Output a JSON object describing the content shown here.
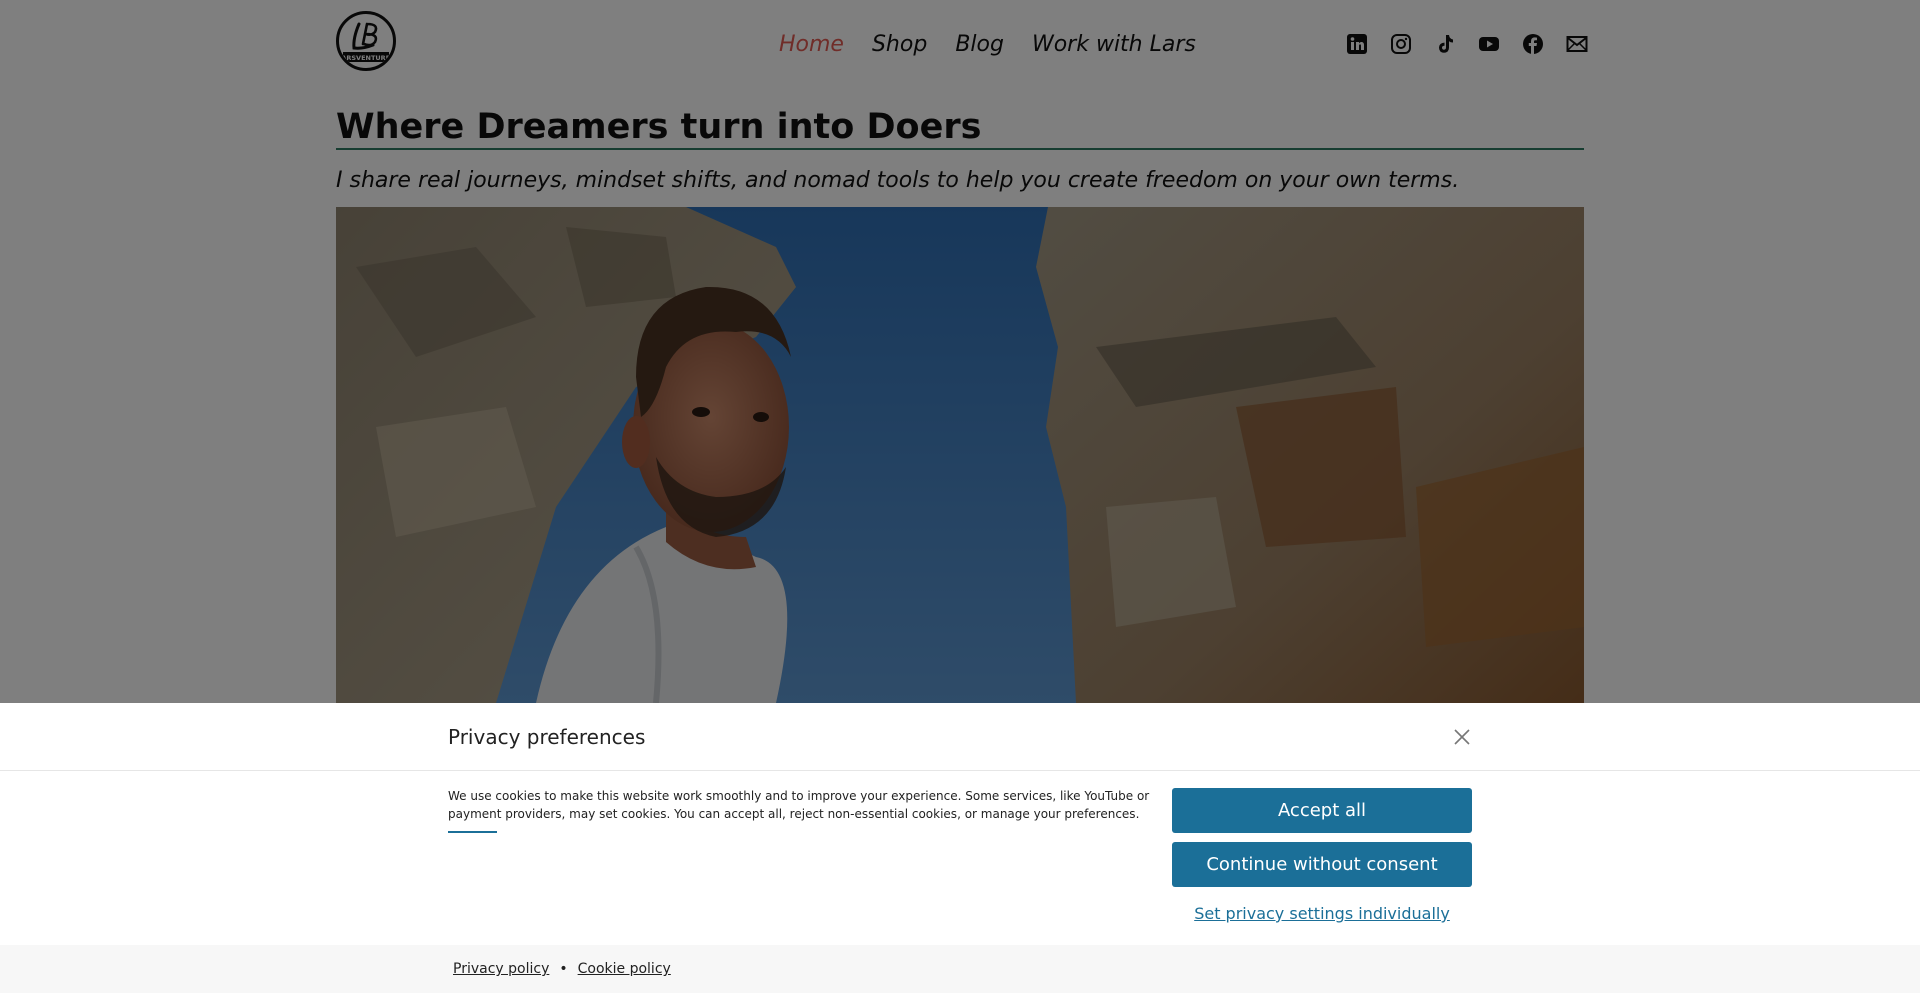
{
  "header": {
    "logo_text": "LB",
    "logo_sub": "LARSVENTURES",
    "nav": [
      {
        "label": "Home",
        "active": true
      },
      {
        "label": "Shop",
        "active": false
      },
      {
        "label": "Blog",
        "active": false
      },
      {
        "label": "Work with Lars",
        "active": false
      }
    ],
    "social_icons": [
      "linkedin-icon",
      "instagram-icon",
      "tiktok-icon",
      "youtube-icon",
      "facebook-icon",
      "mail-icon"
    ]
  },
  "main": {
    "headline": "Where Dreamers turn into Doers",
    "subtitle": "I share real journeys, mindset shifts, and nomad tools to help you create freedom on your own terms."
  },
  "consent": {
    "title": "Privacy preferences",
    "body": "We use cookies to make this website work smoothly and to improve your experience. Some services, like YouTube or payment providers, may set cookies. You can accept all, reject non-essential cookies, or manage your preferences.",
    "accept_label": "Accept all",
    "continue_label": "Continue without consent",
    "settings_label": "Set privacy settings individually",
    "footer": {
      "privacy_label": "Privacy policy",
      "separator": "•",
      "cookie_label": "Cookie policy"
    }
  },
  "colors": {
    "accent": "#1b6f98",
    "nav_active": "#e05a52",
    "rule": "#2f7a63"
  }
}
